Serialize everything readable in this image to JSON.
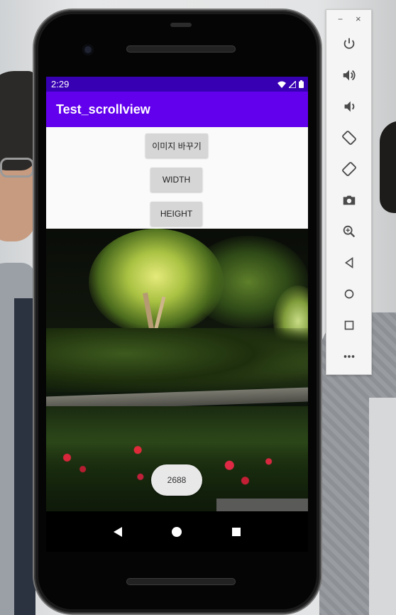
{
  "status_bar": {
    "time": "2:29"
  },
  "app_bar": {
    "title": "Test_scrollview"
  },
  "buttons": {
    "change_image": "이미지 바꾸기",
    "width": "WIDTH",
    "height": "HEIGHT"
  },
  "toast": {
    "text": "2688"
  },
  "emulator_toolbar": {
    "minimize": "−",
    "close": "×",
    "icons": [
      "power-icon",
      "volume-up-icon",
      "volume-down-icon",
      "rotate-left-icon",
      "rotate-right-icon",
      "camera-icon",
      "zoom-icon",
      "back-icon",
      "home-icon",
      "overview-icon",
      "more-icon"
    ]
  },
  "colors": {
    "status_bar": "#3700b3",
    "app_bar": "#6200ee",
    "button_bg": "#d6d6d6"
  }
}
